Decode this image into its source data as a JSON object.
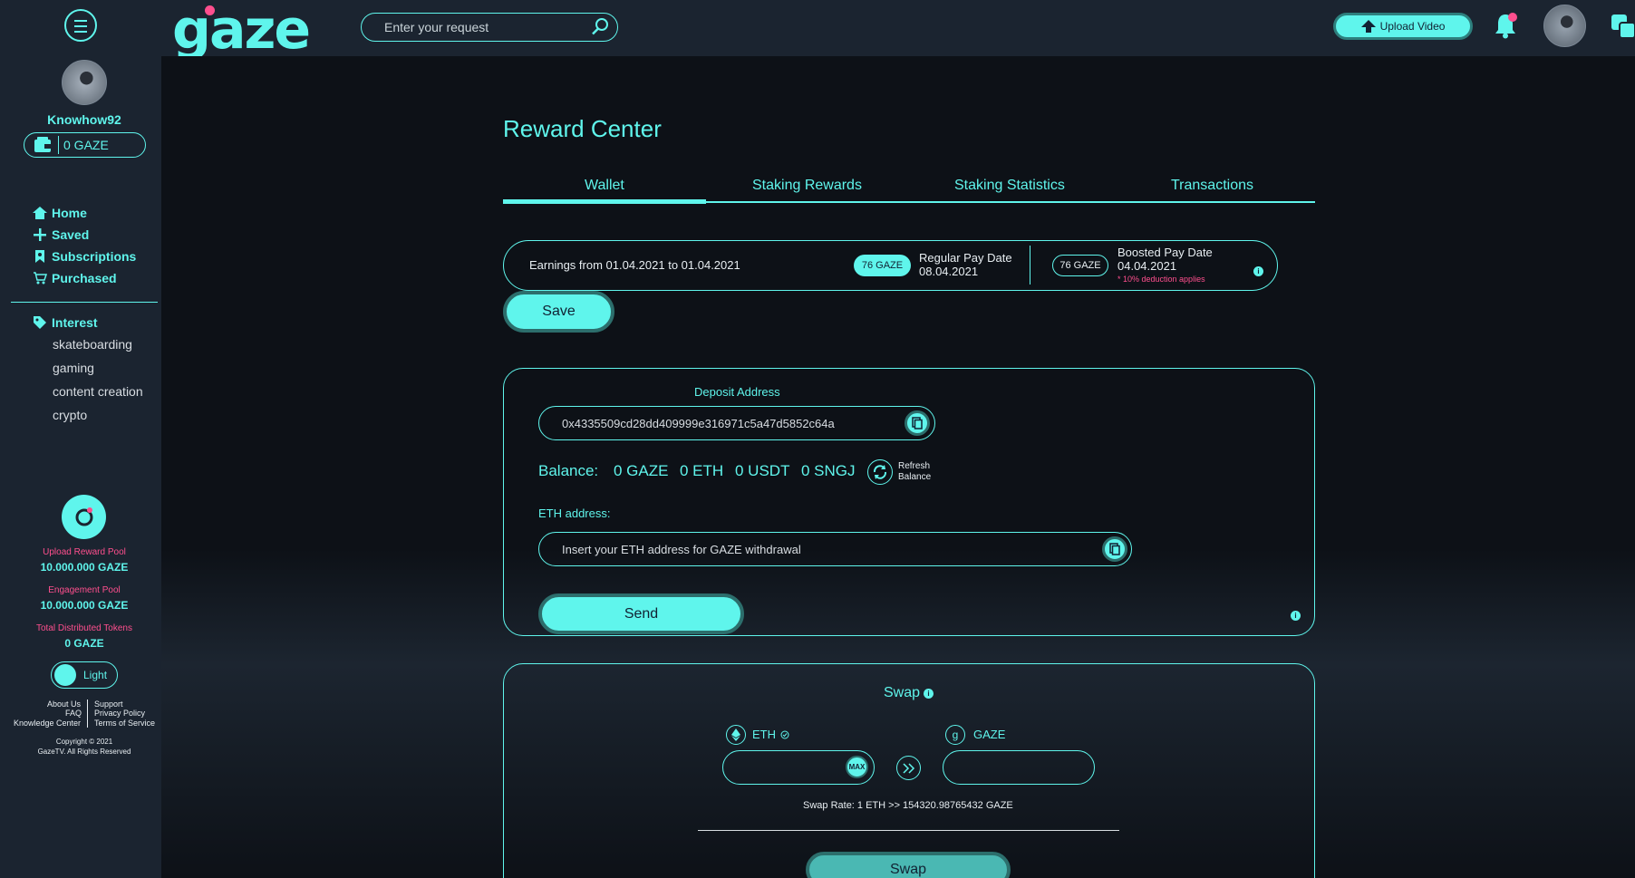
{
  "header": {
    "logo": "gaze",
    "search_placeholder": "Enter your request",
    "upload_label": "Upload Video"
  },
  "sidebar": {
    "username": "Knowhow92",
    "wallet_balance": "0 GAZE",
    "nav": [
      {
        "label": "Home",
        "icon": "home-icon"
      },
      {
        "label": "Saved",
        "icon": "plus-icon"
      },
      {
        "label": "Subscriptions",
        "icon": "bookmark-icon"
      },
      {
        "label": "Purchased",
        "icon": "cart-icon"
      }
    ],
    "interest_label": "Interest",
    "interests": [
      "skateboarding",
      "gaming",
      "content creation",
      "crypto"
    ],
    "pools": [
      {
        "label": "Upload Reward Pool",
        "value": "10.000.000 GAZE"
      },
      {
        "label": "Engagement Pool",
        "value": "10.000.000 GAZE"
      },
      {
        "label": "Total Distributed Tokens",
        "value": "0 GAZE"
      }
    ],
    "theme_label": "Light",
    "footer_left": [
      "About Us",
      "FAQ",
      "Knowledge Center"
    ],
    "footer_right": [
      "Support",
      "Privacy Policy",
      "Terms of Service"
    ],
    "copyright": [
      "Copyright © 2021",
      "GazeTV. All Rights Reserved"
    ]
  },
  "main": {
    "title": "Reward Center",
    "tabs": [
      "Wallet",
      "Staking Rewards",
      "Staking Statistics",
      "Transactions"
    ],
    "earnings": {
      "period": "Earnings from 01.04.2021 to 01.04.2021",
      "regular_amount": "76 GAZE",
      "regular_label": "Regular Pay Date",
      "regular_date": "08.04.2021",
      "boosted_amount": "76 GAZE",
      "boosted_label": "Boosted Pay Date",
      "boosted_date": "04.04.2021",
      "deduction_note": "* 10% deduction applies"
    },
    "save_label": "Save",
    "deposit": {
      "title": "Deposit Address",
      "address": "0x4335509cd28dd409999e316971c5a47d5852c64a",
      "balance_label": "Balance:",
      "balances": [
        "0 GAZE",
        "0 ETH",
        "0 USDT",
        "0 SNGJ"
      ],
      "refresh_label_1": "Refresh",
      "refresh_label_2": "Balance",
      "eth_label": "ETH address:",
      "eth_placeholder": "Insert your ETH address for GAZE withdrawal",
      "send_label": "Send"
    },
    "swap": {
      "title": "Swap",
      "from_token": "ETH",
      "to_token": "GAZE",
      "max_label": "MAX",
      "rate": "Swap Rate: 1 ETH >> 154320.98765432 GAZE",
      "button_label": "Swap"
    }
  }
}
